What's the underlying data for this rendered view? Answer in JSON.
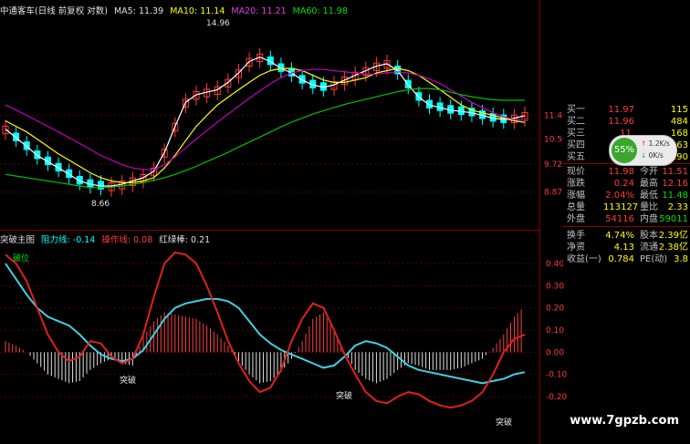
{
  "header": {
    "title": "中通客车(日线 前复权 对数)",
    "ma5_label": "MA5: 11.39",
    "ma10_label": "MA10: 11.14",
    "ma20_label": "MA20: 11.21",
    "ma60_label": "MA60: 11.98"
  },
  "price_axis": [
    "11.40",
    "10.56",
    "9.72",
    "8.87"
  ],
  "price_marks": {
    "high": "14.96",
    "low": "8.66"
  },
  "indicator": {
    "name": "突破主图",
    "resistance": "阻力线: -0.14",
    "operation": "操作线: 0.08",
    "redgreen": "红绿棒: 0.21",
    "axis": [
      "0.40",
      "0.30",
      "0.20",
      "0.10",
      "0.00",
      "-0.10",
      "-0.20"
    ],
    "labels": {
      "start": "破位",
      "b1": "突破",
      "b2": "突破",
      "b3": "突破"
    }
  },
  "order_book": [
    {
      "label": "买一",
      "price": "11.97",
      "qty": "115"
    },
    {
      "label": "买二",
      "price": "11.96",
      "qty": "484"
    },
    {
      "label": "买三",
      "price": "11.",
      "qty": "168"
    },
    {
      "label": "买四",
      "price": "1",
      "qty": "63"
    },
    {
      "label": "买五",
      "price": "1",
      "qty": "190"
    }
  ],
  "quote": [
    {
      "a": "现价",
      "b": "11.98",
      "c": "今开",
      "d": "11.51"
    },
    {
      "a": "涨跌",
      "b": "0.24",
      "c": "最高",
      "d": "12.16"
    },
    {
      "a": "涨幅",
      "b": "2.04%",
      "c": "最低",
      "d": "11.48"
    },
    {
      "a": "总量",
      "b": "113127",
      "c": "量比",
      "d": "2.33"
    },
    {
      "a": "外盘",
      "b": "54116",
      "c": "内盘",
      "d": "59011"
    }
  ],
  "fund": [
    {
      "a": "换手",
      "b": "4.74%",
      "c": "股本",
      "d": "2.39亿"
    },
    {
      "a": "净资",
      "b": "4.13",
      "c": "流通",
      "d": "2.38亿"
    },
    {
      "a": "收益(一)",
      "b": "0.784",
      "c": "PE(动)",
      "d": "3.8"
    }
  ],
  "widget": {
    "pct": "55%",
    "up": "1.2K/s",
    "down": "0K/s"
  },
  "watermark": "www.7gpzb.com",
  "colors": {
    "up": "#ff3c3c",
    "down": "#00ffff",
    "ma5": "#ffffff",
    "ma10": "#ffff00",
    "ma20": "#c000c0",
    "ma60": "#00c000"
  },
  "chart_data": [
    {
      "type": "line",
      "x": [
        1,
        2,
        3,
        4,
        5,
        6,
        7,
        8,
        9,
        10,
        11,
        12,
        13,
        14,
        15,
        16,
        17,
        18,
        19,
        20,
        21,
        22,
        23,
        24,
        25,
        26,
        27,
        28,
        29,
        30,
        31,
        32,
        33,
        34,
        35,
        36,
        37,
        38,
        39,
        40,
        41,
        42,
        43,
        44,
        45,
        46,
        47,
        48,
        49,
        50
      ],
      "series": [
        {
          "name": "MA5",
          "values": [
            10.9,
            10.6,
            10.3,
            10.0,
            9.8,
            9.6,
            9.4,
            9.2,
            9.1,
            9.05,
            9.05,
            9.1,
            9.2,
            9.3,
            9.5,
            10.1,
            11.0,
            11.9,
            12.2,
            12.3,
            12.4,
            12.7,
            13.1,
            13.6,
            13.8,
            13.6,
            13.3,
            13.1,
            12.8,
            12.6,
            12.5,
            12.6,
            12.8,
            13.0,
            13.2,
            13.4,
            13.5,
            13.2,
            12.6,
            12.1,
            11.8,
            11.7,
            11.6,
            11.55,
            11.5,
            11.4,
            11.3,
            11.25,
            11.3,
            11.39
          ]
        },
        {
          "name": "MA10",
          "values": [
            11.2,
            11.0,
            10.8,
            10.55,
            10.3,
            10.05,
            9.85,
            9.65,
            9.45,
            9.3,
            9.2,
            9.15,
            9.15,
            9.2,
            9.3,
            9.6,
            10.0,
            10.5,
            11.0,
            11.4,
            11.8,
            12.1,
            12.4,
            12.7,
            13.0,
            13.2,
            13.3,
            13.3,
            13.2,
            13.0,
            12.8,
            12.7,
            12.7,
            12.8,
            12.9,
            13.1,
            13.2,
            13.3,
            13.2,
            13.0,
            12.7,
            12.4,
            12.1,
            11.8,
            11.6,
            11.5,
            11.4,
            11.3,
            11.2,
            11.14
          ]
        },
        {
          "name": "MA20",
          "values": [
            11.8,
            11.6,
            11.4,
            11.2,
            11.0,
            10.8,
            10.6,
            10.4,
            10.2,
            10.0,
            9.85,
            9.7,
            9.6,
            9.55,
            9.55,
            9.7,
            9.95,
            10.25,
            10.55,
            10.85,
            11.15,
            11.45,
            11.75,
            12.05,
            12.35,
            12.65,
            12.9,
            13.1,
            13.2,
            13.25,
            13.25,
            13.2,
            13.15,
            13.1,
            13.05,
            13.05,
            13.1,
            13.15,
            13.1,
            13.0,
            12.85,
            12.65,
            12.4,
            12.15,
            11.9,
            11.7,
            11.5,
            11.35,
            11.25,
            11.21
          ]
        },
        {
          "name": "MA60",
          "values": [
            9.4,
            9.35,
            9.3,
            9.25,
            9.2,
            9.15,
            9.1,
            9.05,
            9.0,
            9.0,
            9.02,
            9.05,
            9.1,
            9.15,
            9.22,
            9.3,
            9.4,
            9.52,
            9.65,
            9.8,
            9.95,
            10.1,
            10.28,
            10.45,
            10.62,
            10.8,
            10.98,
            11.15,
            11.3,
            11.45,
            11.58,
            11.7,
            11.82,
            11.92,
            12.02,
            12.12,
            12.22,
            12.32,
            12.4,
            12.45,
            12.45,
            12.4,
            12.3,
            12.2,
            12.12,
            12.05,
            12.0,
            11.98,
            11.98,
            11.98
          ]
        }
      ],
      "ylim": [
        8.5,
        15.3
      ],
      "price_labels": [
        "11.40",
        "10.56",
        "9.72",
        "8.87"
      ]
    },
    {
      "type": "line",
      "series": [
        {
          "name": "阻力线",
          "values": [
            0.4,
            0.33,
            0.26,
            0.2,
            0.16,
            0.14,
            0.12,
            0.08,
            0.03,
            -0.01,
            -0.03,
            -0.04,
            -0.03,
            0.01,
            0.08,
            0.15,
            0.2,
            0.22,
            0.23,
            0.24,
            0.24,
            0.23,
            0.2,
            0.14,
            0.08,
            0.04,
            0.01,
            -0.01,
            -0.03,
            -0.05,
            -0.07,
            -0.06,
            -0.02,
            0.03,
            0.05,
            0.04,
            0.02,
            -0.02,
            -0.06,
            -0.08,
            -0.09,
            -0.1,
            -0.11,
            -0.12,
            -0.13,
            -0.14,
            -0.13,
            -0.12,
            -0.1,
            -0.09
          ]
        },
        {
          "name": "操作线",
          "values": [
            0.44,
            0.4,
            0.32,
            0.2,
            0.08,
            0.0,
            -0.04,
            -0.02,
            0.05,
            0.04,
            -0.02,
            -0.05,
            -0.03,
            0.08,
            0.25,
            0.4,
            0.45,
            0.44,
            0.4,
            0.3,
            0.18,
            0.05,
            -0.05,
            -0.13,
            -0.18,
            -0.16,
            -0.08,
            0.05,
            0.15,
            0.22,
            0.2,
            0.1,
            -0.01,
            -0.1,
            -0.18,
            -0.22,
            -0.23,
            -0.2,
            -0.18,
            -0.19,
            -0.22,
            -0.24,
            -0.25,
            -0.24,
            -0.22,
            -0.18,
            -0.1,
            0.0,
            0.06,
            0.08
          ]
        },
        {
          "name": "红绿棒",
          "values": [
            0.05,
            0.03,
            0.0,
            -0.05,
            -0.1,
            -0.12,
            -0.14,
            -0.13,
            -0.08,
            -0.05,
            -0.03,
            -0.05,
            -0.06,
            0.07,
            0.14,
            0.18,
            0.17,
            0.16,
            0.15,
            0.12,
            0.08,
            0.03,
            -0.04,
            -0.1,
            -0.14,
            -0.13,
            -0.09,
            -0.03,
            0.05,
            0.15,
            0.18,
            0.1,
            0.0,
            -0.08,
            -0.12,
            -0.14,
            -0.12,
            -0.08,
            -0.05,
            -0.06,
            -0.08,
            -0.08,
            -0.08,
            -0.07,
            -0.05,
            -0.03,
            0.02,
            0.08,
            0.16,
            0.21
          ]
        }
      ],
      "ylim": [
        -0.27,
        0.47
      ],
      "ticks": [
        "0.40",
        "0.30",
        "0.20",
        "0.10",
        "0.00",
        "-0.10",
        "-0.20"
      ]
    }
  ]
}
